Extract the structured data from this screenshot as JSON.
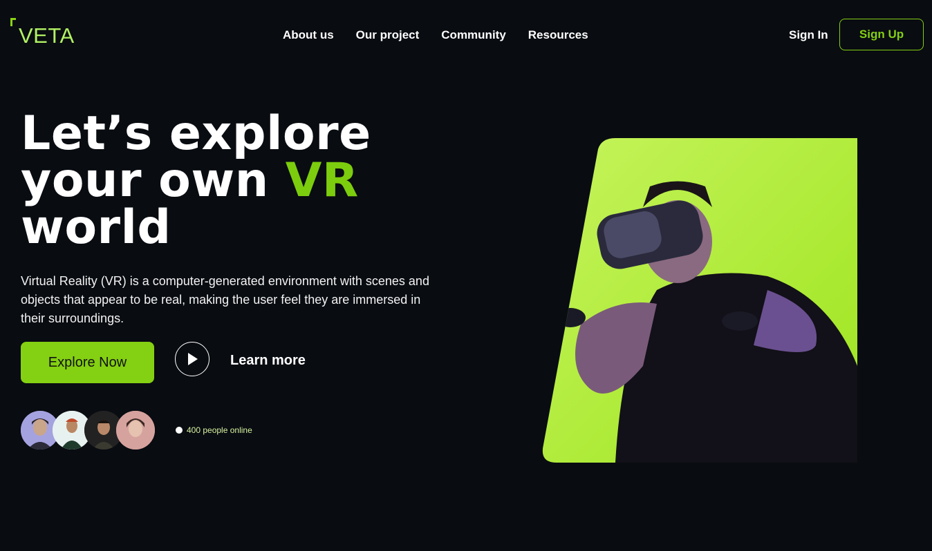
{
  "brand": {
    "name": "VETA"
  },
  "nav": {
    "items": [
      "About us",
      "Our project",
      "Community",
      "Resources"
    ]
  },
  "auth": {
    "sign_in": "Sign In",
    "sign_up": "Sign Up"
  },
  "hero": {
    "line1": "Let’s explore",
    "line2_prefix": "your own ",
    "line2_highlight": "VR",
    "line3": "world",
    "description": "Virtual Reality (VR) is a computer-generated environment with scenes and objects that appear to be real, making the user feel they are immersed in their surroundings.",
    "explore_label": "Explore Now",
    "learn_more": "Learn more"
  },
  "community": {
    "online_text": "400 people online"
  },
  "colors": {
    "accent": "#84d012",
    "background": "#090c11",
    "hero_panel": "#b1f04a"
  },
  "icons": {
    "play": "play-icon",
    "online": "status-dot-icon"
  }
}
